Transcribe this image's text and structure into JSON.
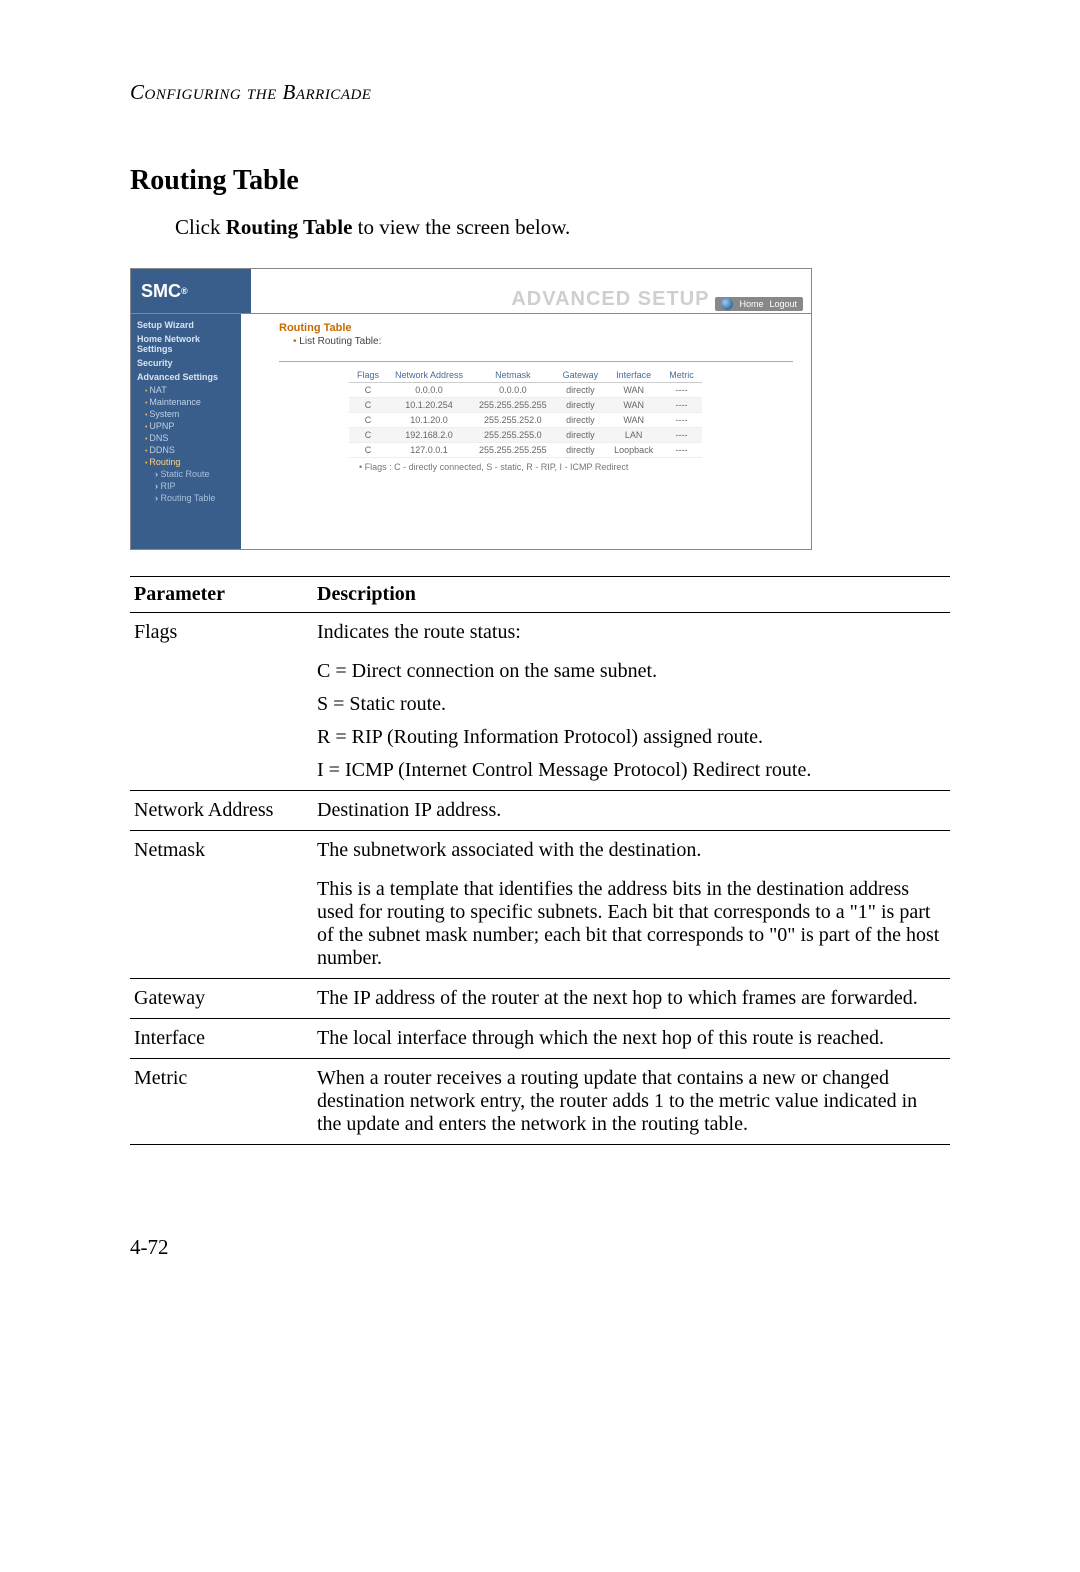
{
  "running_header": "Configuring the Barricade",
  "section_title": "Routing Table",
  "intro_prefix": "Click ",
  "intro_bold": "Routing Table",
  "intro_suffix": " to view the screen below.",
  "router": {
    "logo": "SMC",
    "logo_sup": "®",
    "adv_setup": "ADVANCED SETUP",
    "hdr_home": "Home",
    "hdr_logout": "Logout",
    "sidebar": {
      "setup_wizard": "Setup Wizard",
      "home_net": "Home Network Settings",
      "security": "Security",
      "adv_settings": "Advanced Settings",
      "nat": "NAT",
      "maintenance": "Maintenance",
      "system": "System",
      "upnp": "UPNP",
      "dns": "DNS",
      "ddns": "DDNS",
      "routing": "Routing",
      "static_route": "Static Route",
      "rip": "RIP",
      "routing_table": "Routing Table"
    },
    "panel_title": "Routing Table",
    "panel_sub": "List Routing Table:",
    "table_headers": {
      "flags": "Flags",
      "netaddr": "Network Address",
      "netmask": "Netmask",
      "gateway": "Gateway",
      "interface": "Interface",
      "metric": "Metric"
    },
    "rows": [
      {
        "flags": "C",
        "netaddr": "0.0.0.0",
        "netmask": "0.0.0.0",
        "gateway": "directly",
        "interface": "WAN",
        "metric": "----"
      },
      {
        "flags": "C",
        "netaddr": "10.1.20.254",
        "netmask": "255.255.255.255",
        "gateway": "directly",
        "interface": "WAN",
        "metric": "----"
      },
      {
        "flags": "C",
        "netaddr": "10.1.20.0",
        "netmask": "255.255.252.0",
        "gateway": "directly",
        "interface": "WAN",
        "metric": "----"
      },
      {
        "flags": "C",
        "netaddr": "192.168.2.0",
        "netmask": "255.255.255.0",
        "gateway": "directly",
        "interface": "LAN",
        "metric": "----"
      },
      {
        "flags": "C",
        "netaddr": "127.0.0.1",
        "netmask": "255.255.255.255",
        "gateway": "directly",
        "interface": "Loopback",
        "metric": "----"
      }
    ],
    "flags_note": "Flags :  C - directly connected, S - static, R - RIP, I - ICMP Redirect"
  },
  "param_header_param": "Parameter",
  "param_header_desc": "Description",
  "params": {
    "flags_label": "Flags",
    "flags_line1": "Indicates the route status:",
    "flags_c": "C = Direct connection on the same subnet.",
    "flags_s": "S = Static route.",
    "flags_r": "R = RIP (Routing Information Protocol) assigned route.",
    "flags_i": "I = ICMP (Internet Control Message Protocol) Redirect route.",
    "netaddr_label": "Network Address",
    "netaddr_desc": "Destination IP address.",
    "netmask_label": "Netmask",
    "netmask_line1": "The subnetwork associated with the destination.",
    "netmask_line2": "This is a template that identifies the address bits in the destination address used for routing to specific subnets. Each bit that corresponds to a \"1\" is part of the subnet mask number; each bit that corresponds to \"0\" is part of the host number.",
    "gateway_label": "Gateway",
    "gateway_desc": "The IP address of the router at the next hop to which frames are forwarded.",
    "interface_label": "Interface",
    "interface_desc": "The local interface through which the next hop of this route is reached.",
    "metric_label": "Metric",
    "metric_desc": "When a router receives a routing update that contains a new or changed destination network entry, the router adds 1 to the metric value indicated in the update and enters the network in the routing table."
  },
  "page_num": "4-72"
}
